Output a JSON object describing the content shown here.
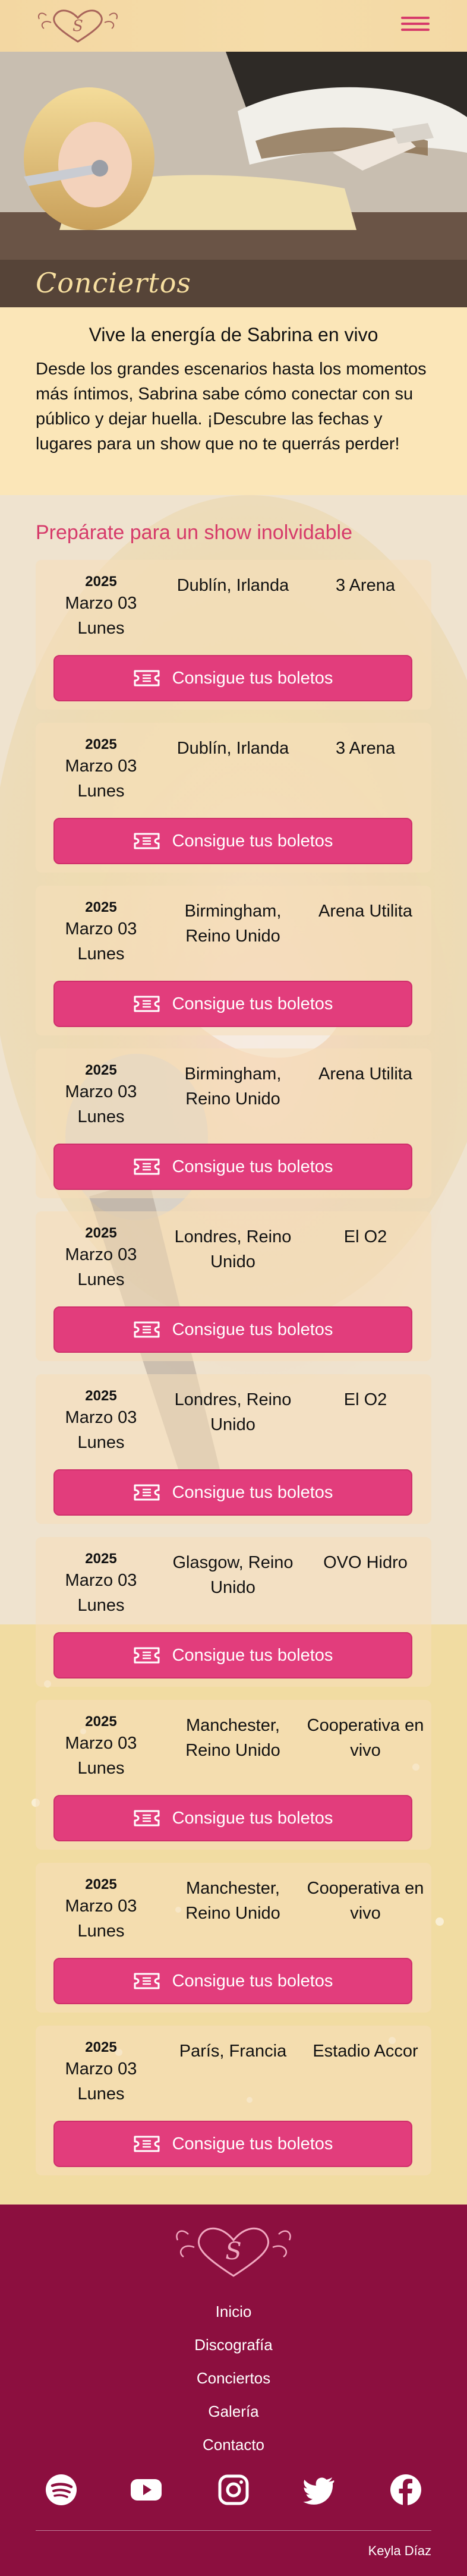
{
  "header": {
    "logo_letter": "S",
    "menu_icon": "hamburger-menu-icon"
  },
  "hero": {
    "title": "Conciertos"
  },
  "intro": {
    "heading": "Vive la energía de Sabrina en vivo",
    "body": "Desde los grandes escenarios hasta los momentos más íntimos, Sabrina sabe cómo conectar con su público y dejar huella. ¡Descubre las fechas y lugares para un show que no te querrás perder!"
  },
  "concerts": {
    "title": "Prepárate para un show inolvidable",
    "button_label": "Consigue tus boletos",
    "button_icon": "ticket-icon",
    "items": [
      {
        "year": "2025",
        "month_day": "Marzo 03",
        "weekday": "Lunes",
        "city": "Dublín, Irlanda",
        "venue": "3 Arena"
      },
      {
        "year": "2025",
        "month_day": "Marzo 03",
        "weekday": "Lunes",
        "city": "Dublín, Irlanda",
        "venue": "3 Arena"
      },
      {
        "year": "2025",
        "month_day": "Marzo 03",
        "weekday": "Lunes",
        "city": "Birmingham, Reino Unido",
        "venue": "Arena Utilita"
      },
      {
        "year": "2025",
        "month_day": "Marzo 03",
        "weekday": "Lunes",
        "city": "Birmingham, Reino Unido",
        "venue": "Arena Utilita"
      },
      {
        "year": "2025",
        "month_day": "Marzo 03",
        "weekday": "Lunes",
        "city": "Londres, Reino Unido",
        "venue": "El O2"
      },
      {
        "year": "2025",
        "month_day": "Marzo 03",
        "weekday": "Lunes",
        "city": "Londres, Reino Unido",
        "venue": "El O2"
      },
      {
        "year": "2025",
        "month_day": "Marzo 03",
        "weekday": "Lunes",
        "city": "Glasgow, Reino Unido",
        "venue": "OVO Hidro"
      },
      {
        "year": "2025",
        "month_day": "Marzo 03",
        "weekday": "Lunes",
        "city": "Manchester, Reino Unido",
        "venue": "Cooperativa en vivo"
      },
      {
        "year": "2025",
        "month_day": "Marzo 03",
        "weekday": "Lunes",
        "city": "Manchester, Reino Unido",
        "venue": "Cooperativa en vivo"
      },
      {
        "year": "2025",
        "month_day": "Marzo 03",
        "weekday": "Lunes",
        "city": "París, Francia",
        "venue": "Estadio Accor"
      }
    ]
  },
  "footer": {
    "logo_letter": "S",
    "nav": [
      "Inicio",
      "Discografía",
      "Conciertos",
      "Galería",
      "Contacto"
    ],
    "social": [
      "spotify-icon",
      "youtube-icon",
      "instagram-icon",
      "twitter-icon",
      "facebook-icon"
    ],
    "credit": "Keyla Díaz"
  },
  "colors": {
    "accent": "#e23d7c",
    "footer_bg": "#8c0f3f",
    "header_bg": "#f3d7a2",
    "title_gold": "#f7dfa0"
  }
}
